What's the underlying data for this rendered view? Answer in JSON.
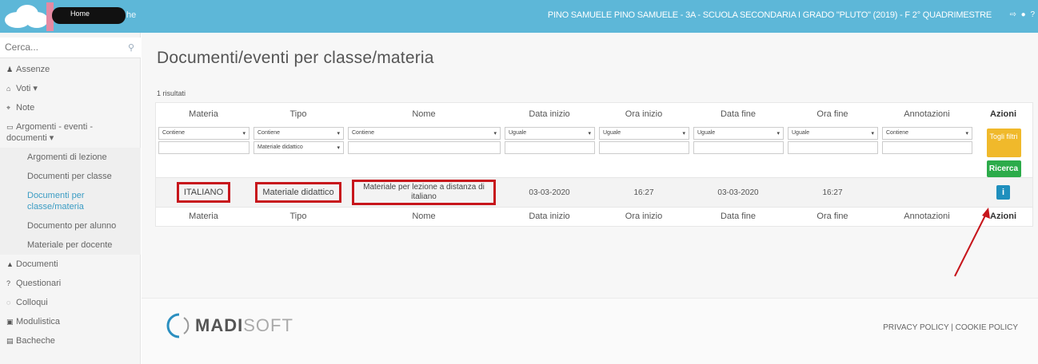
{
  "topbar": {
    "home_label": "Home",
    "ghost_text": "he",
    "user_info": "PINO SAMUELE  PINO SAMUELE - 3A - SCUOLA SECONDARIA I GRADO \"PLUTO\" (2019) - F  2° QUADRIMESTRE",
    "icons": [
      "sign-out-icon",
      "user-icon",
      "help-icon"
    ]
  },
  "sidebar": {
    "search_placeholder": "Cerca...",
    "items": [
      {
        "icon": "user-icon",
        "label": "Assenze"
      },
      {
        "icon": "bank-icon",
        "label": "Voti ▾"
      },
      {
        "icon": "pin-icon",
        "label": "Note"
      },
      {
        "icon": "folder-open-icon",
        "label": "Argomenti - eventi - documenti ▾"
      }
    ],
    "sub_items": [
      "Argomenti di lezione",
      "Documenti per classe",
      "Documenti per classe/materia",
      "Documento per alunno",
      "Materiale per docente"
    ],
    "bottom_items": [
      {
        "icon": "graduation-cap-icon",
        "label": "Documenti"
      },
      {
        "icon": "question-icon",
        "label": "Questionari"
      },
      {
        "icon": "chat-icon",
        "label": "Colloqui"
      },
      {
        "icon": "archive-icon",
        "label": "Modulistica"
      },
      {
        "icon": "board-icon",
        "label": "Bacheche"
      }
    ]
  },
  "main": {
    "title": "Documenti/eventi per classe/materia",
    "results": "1 risultati",
    "columns": [
      "Materia",
      "Tipo",
      "Nome",
      "Data inizio",
      "Ora inizio",
      "Data fine",
      "Ora fine",
      "Annotazioni",
      "Azioni"
    ],
    "filters": {
      "materia": "Contiene",
      "tipo": "Contiene",
      "tipo_value": "Materiale didattico",
      "nome": "Contiene",
      "data_inizio": "Uguale",
      "ora_inizio": "Uguale",
      "data_fine": "Uguale",
      "ora_fine": "Uguale",
      "annotazioni": "Contiene"
    },
    "buttons": {
      "togli_filtri": "Togli filtri",
      "ricerca": "Ricerca",
      "info": "i"
    },
    "row": {
      "materia": "ITALIANO",
      "tipo": "Materiale didattico",
      "nome": "Materiale per lezione a distanza di italiano",
      "data_inizio": "03-03-2020",
      "ora_inizio": "16:27",
      "data_fine": "03-03-2020",
      "ora_fine": "16:27",
      "annotazioni": ""
    }
  },
  "footer": {
    "logo_bold": "MADI",
    "logo_light": "SOFT",
    "policy": "PRIVACY POLICY | COOKIE POLICY"
  },
  "colors": {
    "topbar": "#5db7d8",
    "highlight_box": "#c7161c",
    "togli_filtri": "#f0b92b",
    "ricerca": "#2cab4a",
    "info": "#1f8fbd"
  }
}
